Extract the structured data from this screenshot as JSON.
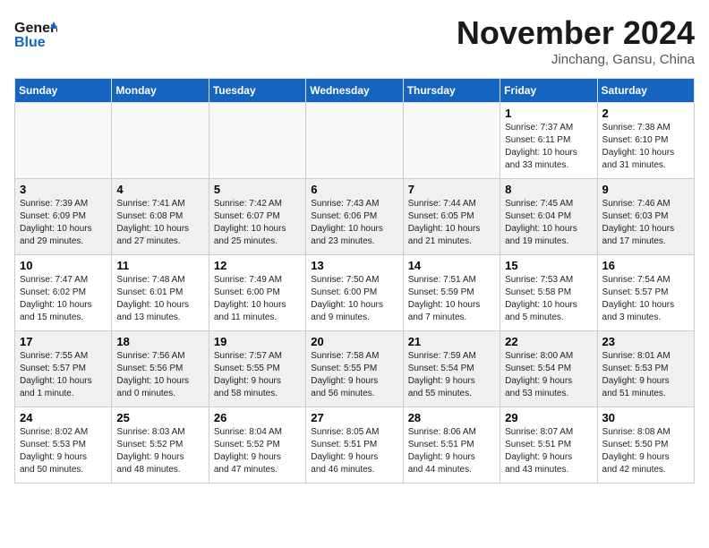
{
  "header": {
    "logo_line1": "General",
    "logo_line2": "Blue",
    "month": "November 2024",
    "location": "Jinchang, Gansu, China"
  },
  "days_of_week": [
    "Sunday",
    "Monday",
    "Tuesday",
    "Wednesday",
    "Thursday",
    "Friday",
    "Saturday"
  ],
  "weeks": [
    [
      {
        "day": "",
        "info": ""
      },
      {
        "day": "",
        "info": ""
      },
      {
        "day": "",
        "info": ""
      },
      {
        "day": "",
        "info": ""
      },
      {
        "day": "",
        "info": ""
      },
      {
        "day": "1",
        "info": "Sunrise: 7:37 AM\nSunset: 6:11 PM\nDaylight: 10 hours\nand 33 minutes."
      },
      {
        "day": "2",
        "info": "Sunrise: 7:38 AM\nSunset: 6:10 PM\nDaylight: 10 hours\nand 31 minutes."
      }
    ],
    [
      {
        "day": "3",
        "info": "Sunrise: 7:39 AM\nSunset: 6:09 PM\nDaylight: 10 hours\nand 29 minutes."
      },
      {
        "day": "4",
        "info": "Sunrise: 7:41 AM\nSunset: 6:08 PM\nDaylight: 10 hours\nand 27 minutes."
      },
      {
        "day": "5",
        "info": "Sunrise: 7:42 AM\nSunset: 6:07 PM\nDaylight: 10 hours\nand 25 minutes."
      },
      {
        "day": "6",
        "info": "Sunrise: 7:43 AM\nSunset: 6:06 PM\nDaylight: 10 hours\nand 23 minutes."
      },
      {
        "day": "7",
        "info": "Sunrise: 7:44 AM\nSunset: 6:05 PM\nDaylight: 10 hours\nand 21 minutes."
      },
      {
        "day": "8",
        "info": "Sunrise: 7:45 AM\nSunset: 6:04 PM\nDaylight: 10 hours\nand 19 minutes."
      },
      {
        "day": "9",
        "info": "Sunrise: 7:46 AM\nSunset: 6:03 PM\nDaylight: 10 hours\nand 17 minutes."
      }
    ],
    [
      {
        "day": "10",
        "info": "Sunrise: 7:47 AM\nSunset: 6:02 PM\nDaylight: 10 hours\nand 15 minutes."
      },
      {
        "day": "11",
        "info": "Sunrise: 7:48 AM\nSunset: 6:01 PM\nDaylight: 10 hours\nand 13 minutes."
      },
      {
        "day": "12",
        "info": "Sunrise: 7:49 AM\nSunset: 6:00 PM\nDaylight: 10 hours\nand 11 minutes."
      },
      {
        "day": "13",
        "info": "Sunrise: 7:50 AM\nSunset: 6:00 PM\nDaylight: 10 hours\nand 9 minutes."
      },
      {
        "day": "14",
        "info": "Sunrise: 7:51 AM\nSunset: 5:59 PM\nDaylight: 10 hours\nand 7 minutes."
      },
      {
        "day": "15",
        "info": "Sunrise: 7:53 AM\nSunset: 5:58 PM\nDaylight: 10 hours\nand 5 minutes."
      },
      {
        "day": "16",
        "info": "Sunrise: 7:54 AM\nSunset: 5:57 PM\nDaylight: 10 hours\nand 3 minutes."
      }
    ],
    [
      {
        "day": "17",
        "info": "Sunrise: 7:55 AM\nSunset: 5:57 PM\nDaylight: 10 hours\nand 1 minute."
      },
      {
        "day": "18",
        "info": "Sunrise: 7:56 AM\nSunset: 5:56 PM\nDaylight: 10 hours\nand 0 minutes."
      },
      {
        "day": "19",
        "info": "Sunrise: 7:57 AM\nSunset: 5:55 PM\nDaylight: 9 hours\nand 58 minutes."
      },
      {
        "day": "20",
        "info": "Sunrise: 7:58 AM\nSunset: 5:55 PM\nDaylight: 9 hours\nand 56 minutes."
      },
      {
        "day": "21",
        "info": "Sunrise: 7:59 AM\nSunset: 5:54 PM\nDaylight: 9 hours\nand 55 minutes."
      },
      {
        "day": "22",
        "info": "Sunrise: 8:00 AM\nSunset: 5:54 PM\nDaylight: 9 hours\nand 53 minutes."
      },
      {
        "day": "23",
        "info": "Sunrise: 8:01 AM\nSunset: 5:53 PM\nDaylight: 9 hours\nand 51 minutes."
      }
    ],
    [
      {
        "day": "24",
        "info": "Sunrise: 8:02 AM\nSunset: 5:53 PM\nDaylight: 9 hours\nand 50 minutes."
      },
      {
        "day": "25",
        "info": "Sunrise: 8:03 AM\nSunset: 5:52 PM\nDaylight: 9 hours\nand 48 minutes."
      },
      {
        "day": "26",
        "info": "Sunrise: 8:04 AM\nSunset: 5:52 PM\nDaylight: 9 hours\nand 47 minutes."
      },
      {
        "day": "27",
        "info": "Sunrise: 8:05 AM\nSunset: 5:51 PM\nDaylight: 9 hours\nand 46 minutes."
      },
      {
        "day": "28",
        "info": "Sunrise: 8:06 AM\nSunset: 5:51 PM\nDaylight: 9 hours\nand 44 minutes."
      },
      {
        "day": "29",
        "info": "Sunrise: 8:07 AM\nSunset: 5:51 PM\nDaylight: 9 hours\nand 43 minutes."
      },
      {
        "day": "30",
        "info": "Sunrise: 8:08 AM\nSunset: 5:50 PM\nDaylight: 9 hours\nand 42 minutes."
      }
    ]
  ]
}
